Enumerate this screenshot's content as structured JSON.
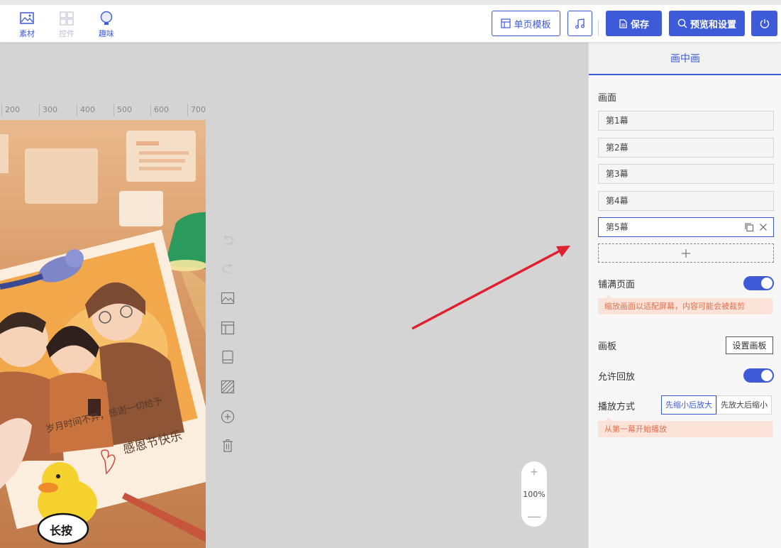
{
  "toolbar": {
    "tools": [
      {
        "label": "素材",
        "icon": "image-icon"
      },
      {
        "label": "控件",
        "icon": "grid-icon"
      },
      {
        "label": "趣味",
        "icon": "bulb-icon"
      }
    ],
    "single_page_template": "单页模板",
    "music_icon": "music-note-icon",
    "save": "保存",
    "preview_settings": "预览和设置",
    "power_icon": "power-icon"
  },
  "ruler": [
    "200",
    "300",
    "400",
    "500",
    "600",
    "700"
  ],
  "canvas": {
    "text_line_1": "岁月时间不弃，感谢一切给予",
    "text_line_2": "感恩节快乐",
    "badge": "长按"
  },
  "zoom": {
    "plus": "+",
    "value": "100%",
    "minus": "—"
  },
  "panel": {
    "tab": "画中画",
    "section_picture": "画面",
    "scenes": [
      "第1幕",
      "第2幕",
      "第3幕",
      "第4幕",
      "第5幕"
    ],
    "fill_page_label": "铺满页面",
    "fill_page_notice": "缩放画面以适配屏幕，内容可能会被裁剪",
    "board_label": "画板",
    "board_button": "设置画板",
    "allow_replay_label": "允许回放",
    "play_mode_label": "播放方式",
    "play_mode_options": [
      "先缩小后放大",
      "先放大后缩小"
    ],
    "play_notice": "从第一幕开始播放"
  },
  "colors": {
    "accent": "#3d5bd8",
    "notice_bg": "#fbe3da",
    "notice_text": "#e0704a",
    "arrow": "#e02030"
  }
}
